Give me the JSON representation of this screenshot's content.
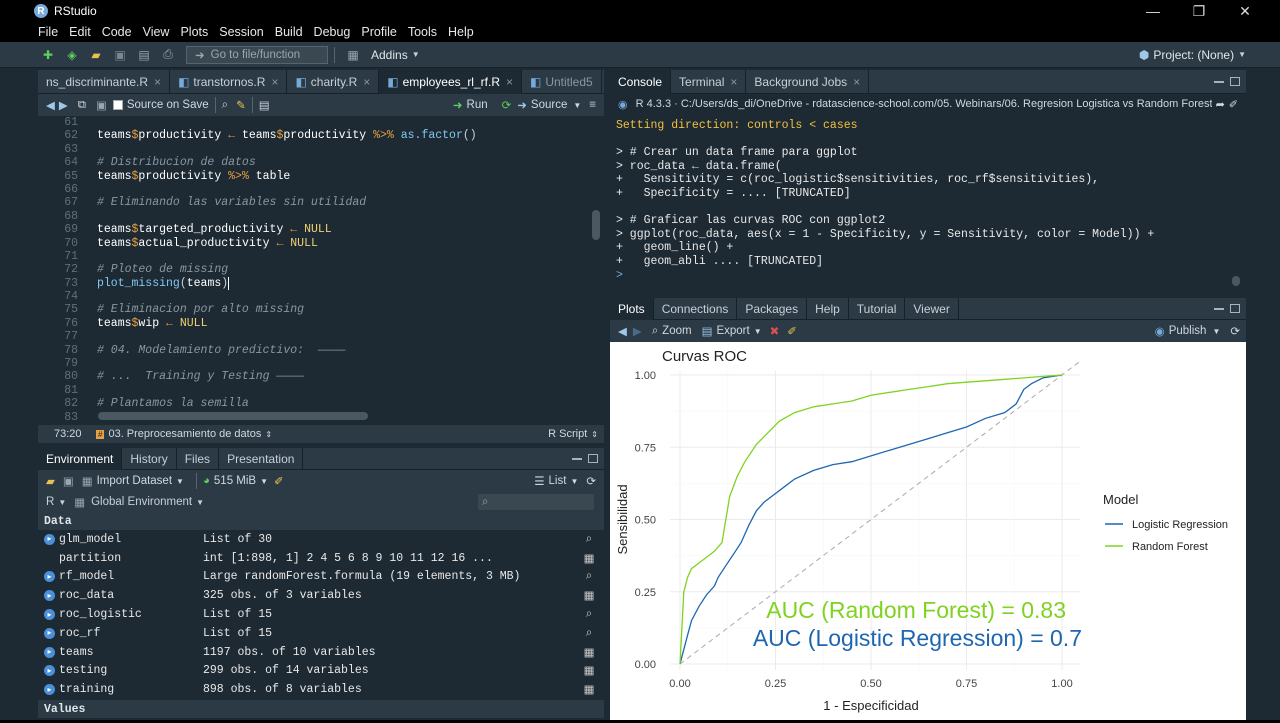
{
  "window": {
    "title": "RStudio",
    "logo": "R",
    "controls": [
      "—",
      "❐",
      "✕"
    ]
  },
  "menu": [
    "File",
    "Edit",
    "Code",
    "View",
    "Plots",
    "Session",
    "Build",
    "Debug",
    "Profile",
    "Tools",
    "Help"
  ],
  "toolbar": {
    "goto_placeholder": "Go to file/function",
    "addins": "Addins",
    "project": "Project: (None)"
  },
  "editor": {
    "tabs": [
      "ns_discriminante.R",
      "transtornos.R",
      "charity.R",
      "employees_rl_rf.R",
      "Untitled5"
    ],
    "active_tab": 3,
    "source_on_save": "Source on Save",
    "run": "Run",
    "source": "Source",
    "lines": [
      {
        "n": "61",
        "html": ""
      },
      {
        "n": "62",
        "html": "<span class='kw'>teams</span><span class='op'>$</span><span class='kw'>productivity</span> <span class='op'>←</span> <span class='kw'>teams</span><span class='op'>$</span><span class='kw'>productivity</span> <span class='op'>%>%</span> <span class='fn'>as.factor</span>()"
      },
      {
        "n": "63",
        "html": ""
      },
      {
        "n": "64",
        "html": "<span class='com'># Distribucion de datos</span>"
      },
      {
        "n": "65",
        "html": "<span class='kw'>teams</span><span class='op'>$</span><span class='kw'>productivity</span> <span class='op'>%>%</span> <span class='kw'>table</span>"
      },
      {
        "n": "66",
        "html": ""
      },
      {
        "n": "67",
        "html": "<span class='com'># Eliminando las variables sin utilidad</span>"
      },
      {
        "n": "68",
        "html": ""
      },
      {
        "n": "69",
        "html": "<span class='kw'>teams</span><span class='op'>$</span><span class='kw'>targeted_productivity</span> <span class='op'>←</span> <span class='null'>NULL</span>"
      },
      {
        "n": "70",
        "html": "<span class='kw'>teams</span><span class='op'>$</span><span class='kw'>actual_productivity</span> <span class='op'>←</span> <span class='null'>NULL</span>"
      },
      {
        "n": "71",
        "html": ""
      },
      {
        "n": "72",
        "html": "<span class='com'># Ploteo de missing</span>"
      },
      {
        "n": "73",
        "html": "<span class='fn'>plot_missing</span>(<span class='kw'>teams</span>)<span style='border-left:1px solid #fff'></span>"
      },
      {
        "n": "74",
        "html": ""
      },
      {
        "n": "75",
        "html": "<span class='com'># Eliminacion por alto missing</span>"
      },
      {
        "n": "76",
        "html": "<span class='kw'>teams</span><span class='op'>$</span><span class='kw'>wip</span> <span class='op'>←</span> <span class='null'>NULL</span>"
      },
      {
        "n": "77",
        "html": ""
      },
      {
        "n": "78",
        "html": "<span class='com'># 04. Modelamiento predictivo:  ————</span>"
      },
      {
        "n": "79",
        "html": ""
      },
      {
        "n": "80",
        "html": "<span class='com'># ...  Training y Testing ————</span>"
      },
      {
        "n": "81",
        "html": ""
      },
      {
        "n": "82",
        "html": "<span class='com'># Plantamos la semilla</span>"
      },
      {
        "n": "83",
        "html": ""
      }
    ],
    "status_pos": "73:20",
    "status_section": "03. Preprocesamiento de datos",
    "status_lang": "R Script"
  },
  "env": {
    "tabs": [
      "Environment",
      "History",
      "Files",
      "Presentation"
    ],
    "import": "Import Dataset",
    "memory": "515 MiB",
    "list": "List",
    "lang": "R",
    "global": "Global Environment",
    "data_header": "Data",
    "values_header": "Values",
    "rows": [
      {
        "name": "glm_model",
        "value": "List of  30",
        "expand": true,
        "icon": "search"
      },
      {
        "name": "partition",
        "value": "int [1:898, 1] 2 4 5 6 8 9 10 11 12 16 ...",
        "expand": false,
        "icon": "grid"
      },
      {
        "name": "rf_model",
        "value": "Large randomForest.formula (19 elements,  3 MB)",
        "expand": true,
        "icon": "search"
      },
      {
        "name": "roc_data",
        "value": "325 obs. of 3 variables",
        "expand": true,
        "icon": "grid"
      },
      {
        "name": "roc_logistic",
        "value": "List of  15",
        "expand": true,
        "icon": "search"
      },
      {
        "name": "roc_rf",
        "value": "List of  15",
        "expand": true,
        "icon": "search"
      },
      {
        "name": "teams",
        "value": "1197 obs. of 10 variables",
        "expand": true,
        "icon": "grid"
      },
      {
        "name": "testing",
        "value": "299 obs. of 14 variables",
        "expand": true,
        "icon": "grid"
      },
      {
        "name": "training",
        "value": "898 obs. of 8 variables",
        "expand": true,
        "icon": "grid"
      }
    ]
  },
  "console": {
    "tabs": [
      "Console",
      "Terminal",
      "Background Jobs"
    ],
    "path": "R 4.3.3  ·  C:/Users/ds_di/OneDrive - rdatascience-school.com/05. Webinars/06. Regresion Logistica vs Random Forest/",
    "lines": [
      {
        "c": "yel",
        "t": "Setting direction: controls < cases"
      },
      {
        "c": "",
        "t": ""
      },
      {
        "c": "",
        "t": "> # Crear un data frame para ggplot"
      },
      {
        "c": "",
        "t": "> roc_data ← data.frame("
      },
      {
        "c": "",
        "t": "+   Sensitivity = c(roc_logistic$sensitivities, roc_rf$sensitivities),"
      },
      {
        "c": "",
        "t": "+   Specificity = .... [TRUNCATED]"
      },
      {
        "c": "",
        "t": ""
      },
      {
        "c": "",
        "t": "> # Graficar las curvas ROC con ggplot2"
      },
      {
        "c": "",
        "t": "> ggplot(roc_data, aes(x = 1 - Specificity, y = Sensitivity, color = Model)) +"
      },
      {
        "c": "",
        "t": "+   geom_line() +"
      },
      {
        "c": "",
        "t": "+   geom_abli .... [TRUNCATED]"
      },
      {
        "c": "",
        "t": ">"
      }
    ]
  },
  "plots": {
    "tabs": [
      "Plots",
      "Connections",
      "Packages",
      "Help",
      "Tutorial",
      "Viewer"
    ],
    "zoom": "Zoom",
    "export": "Export",
    "publish": "Publish"
  },
  "chart_data": {
    "type": "line",
    "title": "Curvas ROC",
    "xlabel": "1 - Especificidad",
    "ylabel": "Sensibilidad",
    "xlim": [
      0,
      1
    ],
    "ylim": [
      0,
      1
    ],
    "xticks": [
      "0.00",
      "0.25",
      "0.50",
      "0.75",
      "1.00"
    ],
    "yticks": [
      "0.00",
      "0.25",
      "0.50",
      "0.75",
      "1.00"
    ],
    "legend_title": "Model",
    "legend_position": "right",
    "grid": true,
    "annotations": [
      {
        "text": "AUC (Random Forest) = 0.83",
        "color": "#7fd320"
      },
      {
        "text": "AUC (Logistic Regression) = 0.7",
        "color": "#1f66b0"
      }
    ],
    "series": [
      {
        "name": "Logistic Regression",
        "color": "#1f66b0",
        "x": [
          0,
          0.01,
          0.02,
          0.03,
          0.05,
          0.07,
          0.09,
          0.1,
          0.12,
          0.14,
          0.16,
          0.18,
          0.2,
          0.22,
          0.25,
          0.28,
          0.3,
          0.35,
          0.4,
          0.45,
          0.5,
          0.55,
          0.6,
          0.65,
          0.7,
          0.75,
          0.8,
          0.85,
          0.88,
          0.9,
          0.92,
          0.95,
          1.0
        ],
        "y": [
          0,
          0.05,
          0.1,
          0.15,
          0.2,
          0.24,
          0.27,
          0.3,
          0.34,
          0.38,
          0.42,
          0.48,
          0.53,
          0.56,
          0.59,
          0.62,
          0.64,
          0.67,
          0.69,
          0.7,
          0.72,
          0.74,
          0.76,
          0.78,
          0.8,
          0.82,
          0.85,
          0.87,
          0.9,
          0.95,
          0.97,
          0.99,
          1.0
        ]
      },
      {
        "name": "Random Forest",
        "color": "#7fd320",
        "x": [
          0,
          0.01,
          0.02,
          0.03,
          0.05,
          0.07,
          0.09,
          0.11,
          0.12,
          0.13,
          0.15,
          0.17,
          0.2,
          0.23,
          0.26,
          0.3,
          0.35,
          0.4,
          0.45,
          0.5,
          0.55,
          0.6,
          0.65,
          0.7,
          0.75,
          0.8,
          0.85,
          0.9,
          0.95,
          1.0
        ],
        "y": [
          0,
          0.25,
          0.3,
          0.33,
          0.35,
          0.37,
          0.39,
          0.42,
          0.5,
          0.58,
          0.65,
          0.7,
          0.76,
          0.8,
          0.84,
          0.87,
          0.89,
          0.9,
          0.91,
          0.93,
          0.94,
          0.95,
          0.96,
          0.97,
          0.975,
          0.98,
          0.985,
          0.99,
          0.995,
          1.0
        ]
      }
    ]
  }
}
